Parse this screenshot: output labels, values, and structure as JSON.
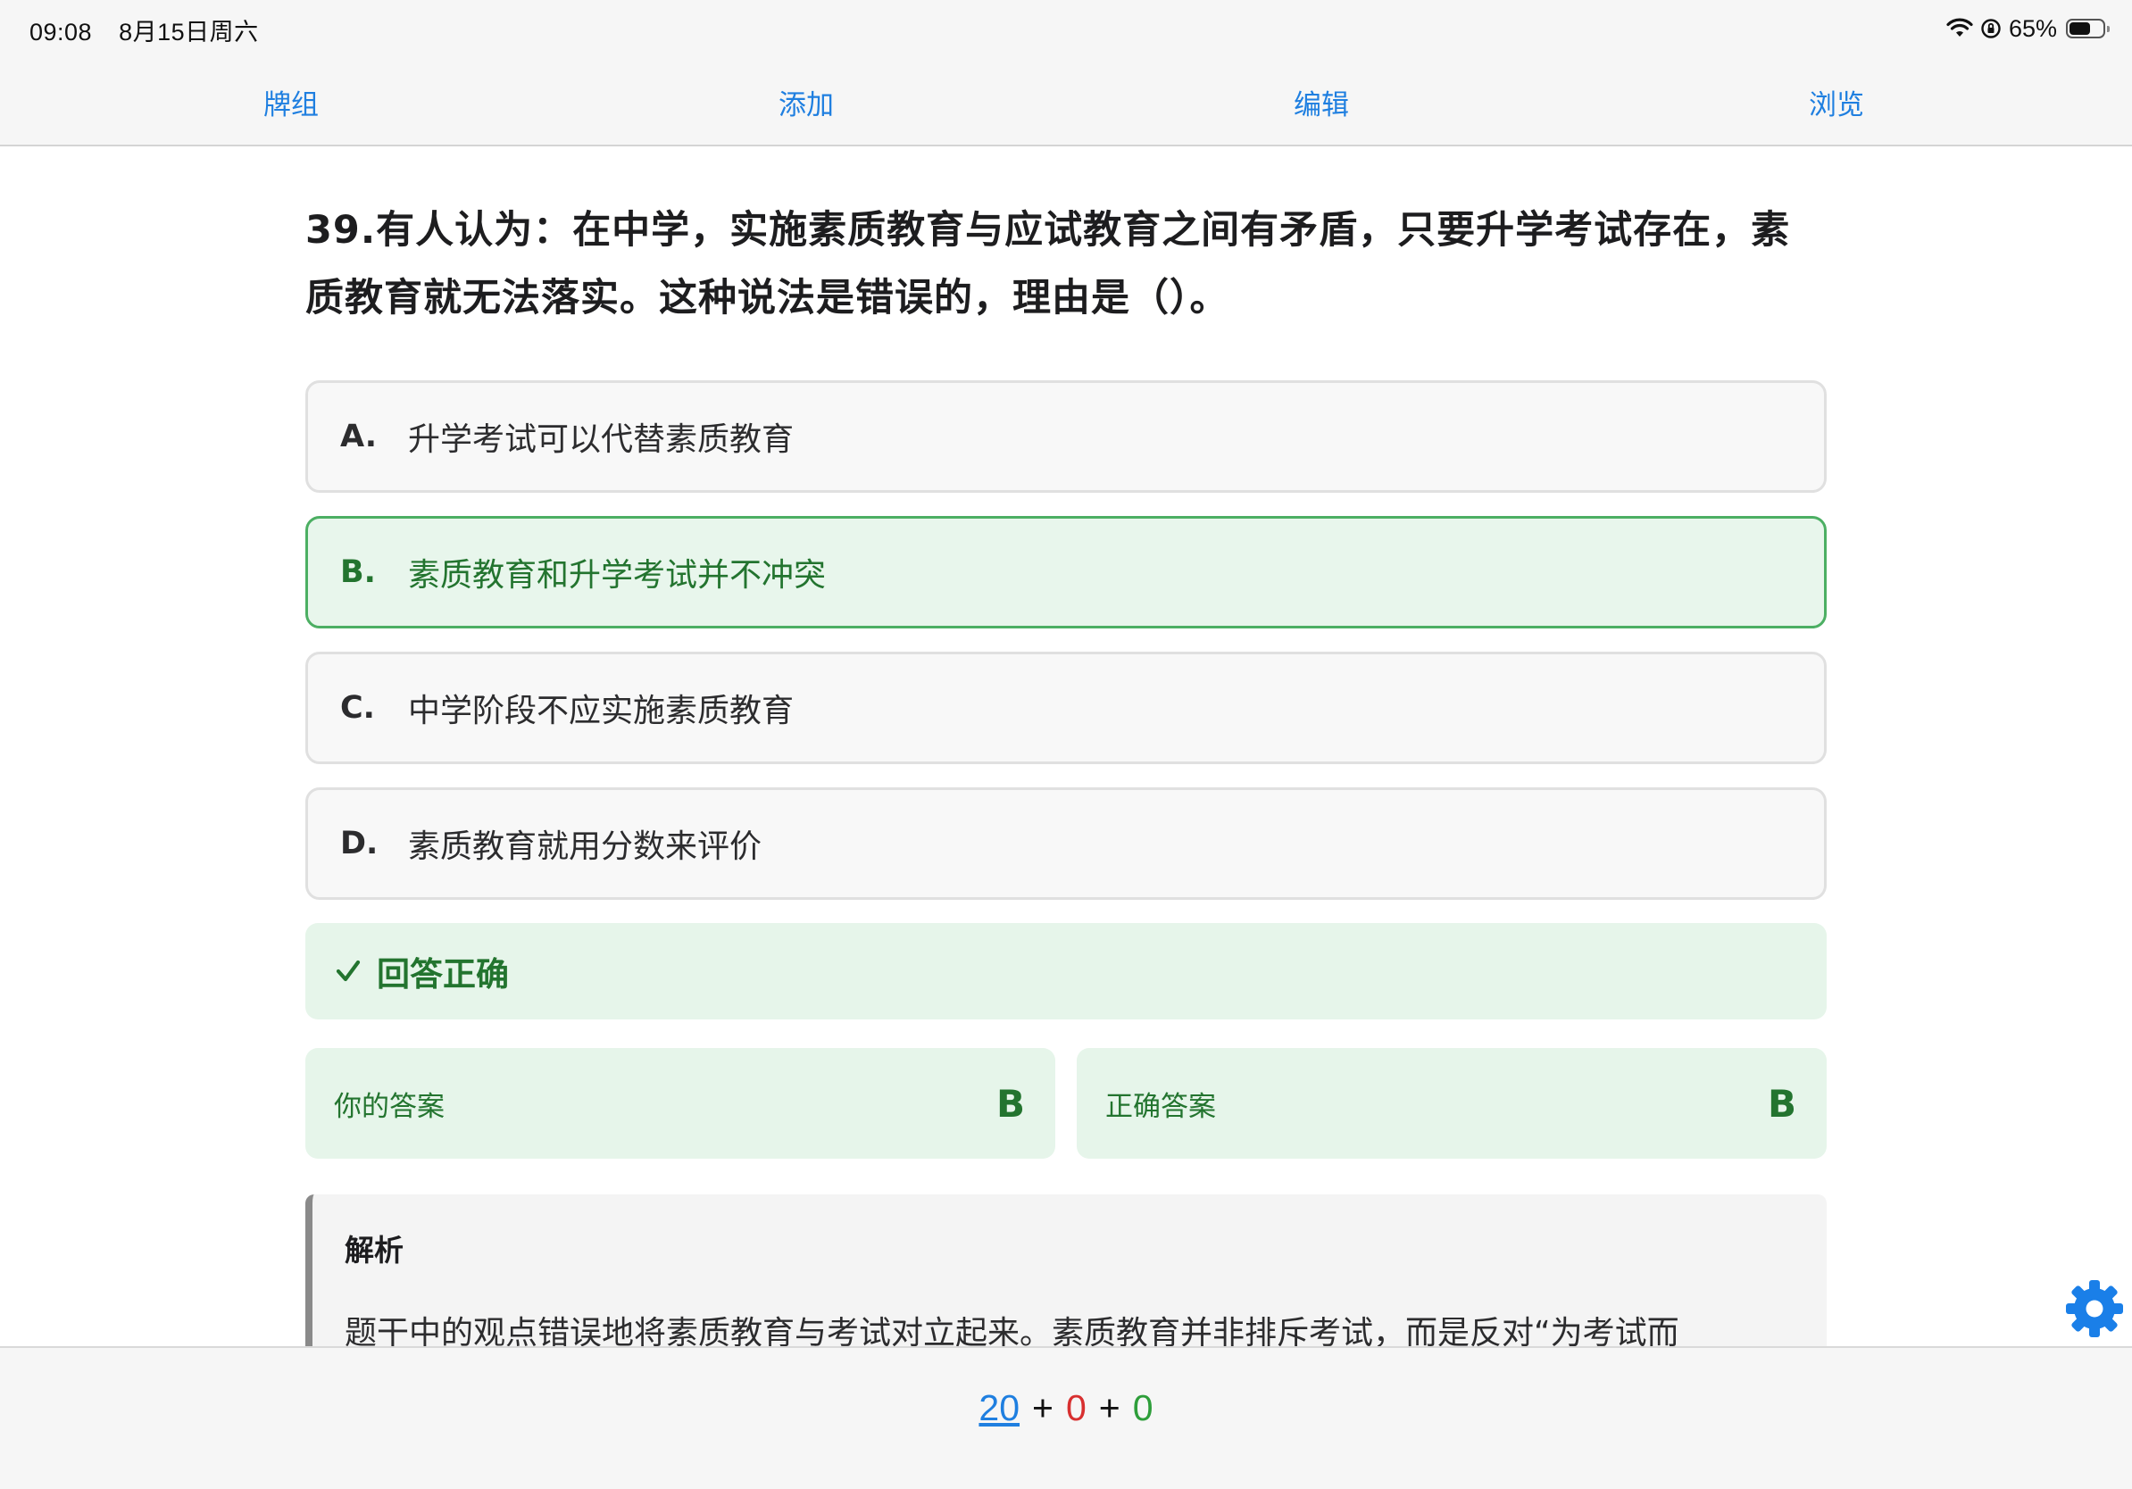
{
  "status_bar": {
    "time": "09:08",
    "date": "8月15日周六",
    "battery_text": "65%",
    "battery_level": 0.65,
    "icons": [
      "wifi-icon",
      "orientation-lock-icon",
      "battery-icon"
    ]
  },
  "nav": {
    "decks": "牌组",
    "add": "添加",
    "edit": "编辑",
    "browse": "浏览"
  },
  "question": {
    "text": "39.有人认为：在中学，实施素质教育与应试教育之间有矛盾，只要升学考试存在，素质教育就无法落实。这种说法是错误的，理由是（）。"
  },
  "options": [
    {
      "letter": "A.",
      "text": "升学考试可以代替素质教育",
      "state": "normal"
    },
    {
      "letter": "B.",
      "text": "素质教育和升学考试并不冲突",
      "state": "correct"
    },
    {
      "letter": "C.",
      "text": "中学阶段不应实施素质教育",
      "state": "normal"
    },
    {
      "letter": "D.",
      "text": "素质教育就用分数来评价",
      "state": "normal"
    }
  ],
  "result": {
    "text": "回答正确",
    "icon": "check-icon"
  },
  "answers": {
    "yours_label": "你的答案",
    "yours_value": "B",
    "correct_label": "正确答案",
    "correct_value": "B"
  },
  "analysis": {
    "title": "解析",
    "body": "题干中的观点错误地将素质教育与考试对立起来。素质教育并非排斥考试，而是反对“为考试而"
  },
  "bottom": {
    "new_count": "20",
    "learn_count": "0",
    "review_count": "0",
    "plus": "+"
  },
  "colors": {
    "accent_blue": "#1f7fe0",
    "correct_green": "#23742f",
    "correct_bg": "#e6f5ea",
    "learn_red": "#d83030",
    "review_green": "#2e9e3a"
  }
}
